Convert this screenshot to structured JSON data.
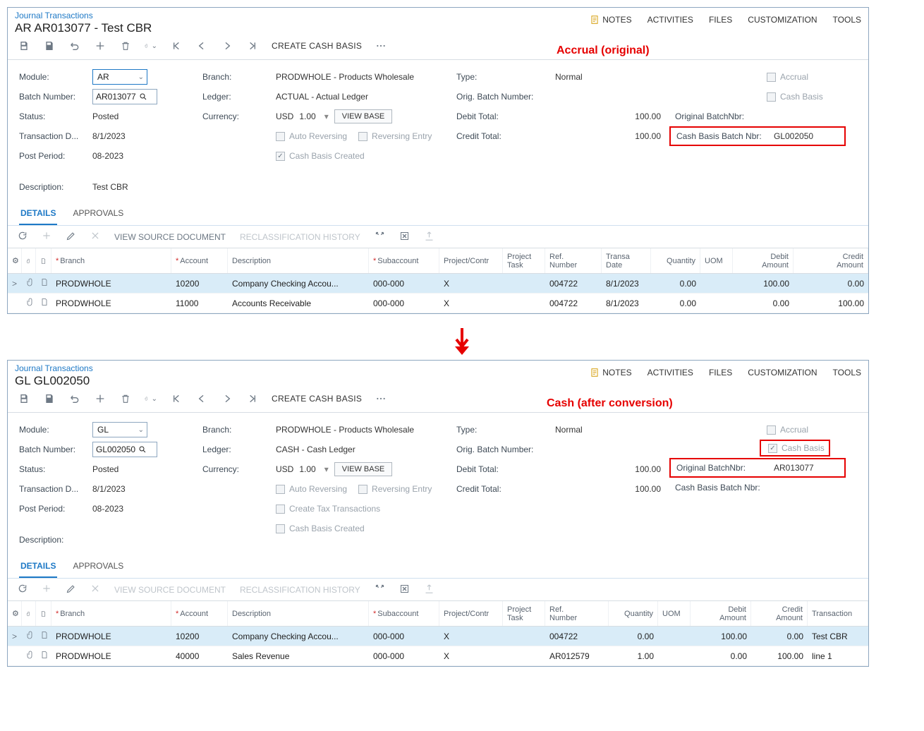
{
  "common": {
    "breadcrumb": "Journal Transactions",
    "links": {
      "notes": "NOTES",
      "activities": "ACTIVITIES",
      "files": "FILES",
      "customization": "CUSTOMIZATION",
      "tools": "TOOLS"
    },
    "toolbar": {
      "create_cash": "CREATE CASH BASIS"
    },
    "labels": {
      "module": "Module:",
      "batch_number": "Batch Number:",
      "status": "Status:",
      "tx_date": "Transaction D...",
      "post_period": "Post Period:",
      "description": "Description:",
      "branch": "Branch:",
      "ledger": "Ledger:",
      "currency": "Currency:",
      "auto_rev": "Auto Reversing",
      "rev_entry": "Reversing Entry",
      "create_tax": "Create Tax Transactions",
      "cash_created": "Cash Basis Created",
      "type": "Type:",
      "orig_batch": "Orig. Batch Number:",
      "debit": "Debit Total:",
      "credit": "Credit Total:",
      "accrual": "Accrual",
      "cash_basis": "Cash Basis",
      "orig_batch_nbr": "Original BatchNbr:",
      "cash_batch_nbr": "Cash Basis Batch Nbr:",
      "view_base": "VIEW BASE"
    },
    "tabbar": {
      "details": "DETAILS",
      "approvals": "APPROVALS"
    },
    "gridtb": {
      "view_src": "VIEW SOURCE DOCUMENT",
      "reclass": "RECLASSIFICATION HISTORY"
    },
    "gridcols": {
      "branch": "Branch",
      "account": "Account",
      "desc": "Description",
      "sub": "Subaccount",
      "proj": "Project/Contr",
      "projtask": "Project\nTask",
      "ref": "Ref.\nNumber",
      "tdate": "Transa\nDate",
      "qty": "Quantity",
      "uom": "UOM",
      "debit": "Debit\nAmount",
      "credit": "Credit\nAmount",
      "txdesc": "Transaction"
    }
  },
  "annot": {
    "top": "Accrual (original)",
    "bottom": "Cash (after conversion)"
  },
  "top": {
    "title": "AR AR013077 - Test CBR",
    "module": "AR",
    "batch": "AR013077",
    "status": "Posted",
    "txdate": "8/1/2023",
    "period": "08-2023",
    "desc": "Test CBR",
    "branch": "PRODWHOLE - Products Wholesale",
    "ledger": "ACTUAL - Actual Ledger",
    "curr": "USD",
    "rate": "1.00",
    "cash_created": true,
    "type": "Normal",
    "orig_batch": "",
    "debit": "100.00",
    "credit": "100.00",
    "accrual": false,
    "cashbasis": false,
    "orig_batch_nbr": "",
    "cash_batch_nbr": "GL002050",
    "rows": [
      {
        "branch": "PRODWHOLE",
        "acct": "10200",
        "desc": "Company Checking Accou...",
        "sub": "000-000",
        "proj": "X",
        "ref": "004722",
        "date": "8/1/2023",
        "qty": "0.00",
        "debit": "100.00",
        "credit": "0.00"
      },
      {
        "branch": "PRODWHOLE",
        "acct": "11000",
        "desc": "Accounts Receivable",
        "sub": "000-000",
        "proj": "X",
        "ref": "004722",
        "date": "8/1/2023",
        "qty": "0.00",
        "debit": "0.00",
        "credit": "100.00"
      }
    ]
  },
  "bottom": {
    "title": "GL GL002050",
    "module": "GL",
    "batch": "GL002050",
    "status": "Posted",
    "txdate": "8/1/2023",
    "period": "08-2023",
    "desc": "",
    "branch": "PRODWHOLE - Products Wholesale",
    "ledger": "CASH - Cash Ledger",
    "curr": "USD",
    "rate": "1.00",
    "create_tax": false,
    "cash_created": false,
    "type": "Normal",
    "orig_batch": "",
    "debit": "100.00",
    "credit": "100.00",
    "accrual": false,
    "cashbasis": true,
    "orig_batch_nbr": "AR013077",
    "cash_batch_nbr": "",
    "rows": [
      {
        "branch": "PRODWHOLE",
        "acct": "10200",
        "desc": "Company Checking Accou...",
        "sub": "000-000",
        "proj": "X",
        "ref": "004722",
        "qty": "0.00",
        "debit": "100.00",
        "credit": "0.00",
        "txdesc": "Test CBR"
      },
      {
        "branch": "PRODWHOLE",
        "acct": "40000",
        "desc": "Sales Revenue",
        "sub": "000-000",
        "proj": "X",
        "ref": "AR012579",
        "qty": "1.00",
        "debit": "0.00",
        "credit": "100.00",
        "txdesc": "line 1"
      }
    ]
  }
}
